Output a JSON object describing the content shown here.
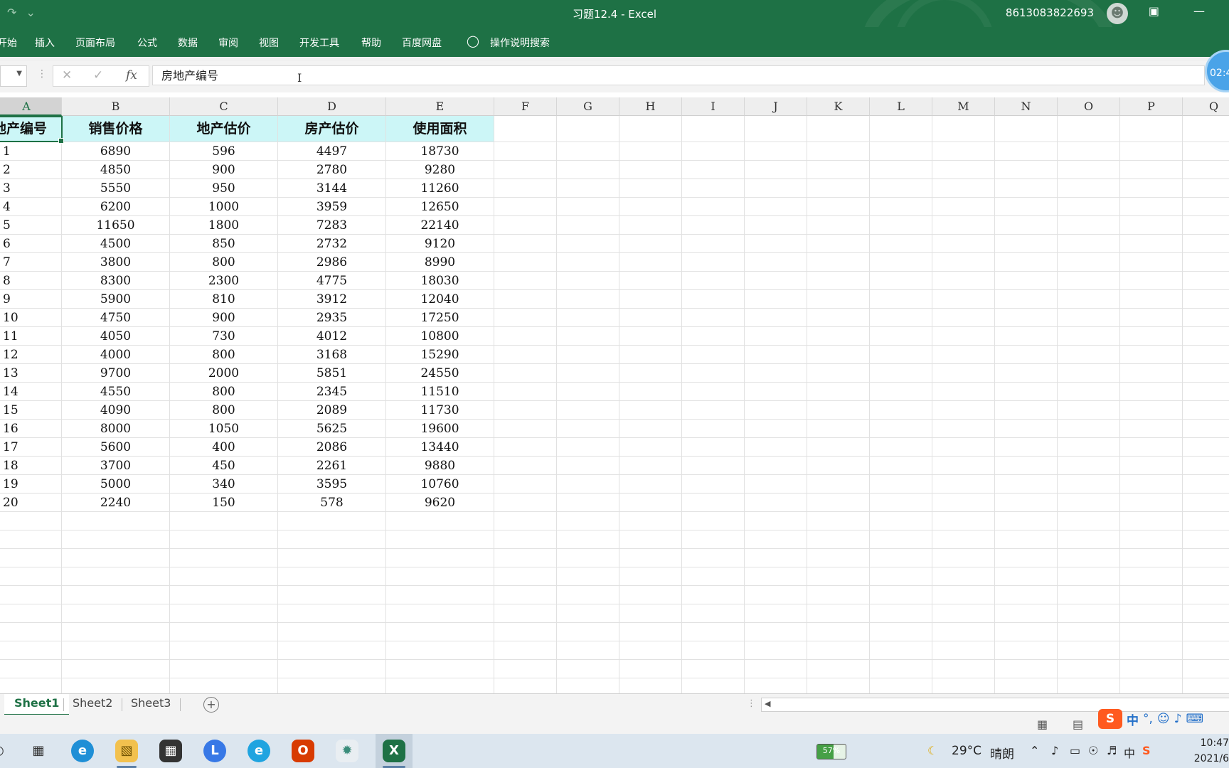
{
  "window": {
    "title": "习题12.4  -  Excel",
    "account": "8613083822693",
    "qat_redo": "↷",
    "qat_menu": "⌄"
  },
  "ribbon": {
    "tabs": [
      "开始",
      "插入",
      "页面布局",
      "公式",
      "数据",
      "审阅",
      "视图",
      "开发工具",
      "帮助",
      "百度网盘"
    ],
    "search": "操作说明搜索"
  },
  "formula_bar": {
    "cancel": "✕",
    "enter": "✓",
    "fx": "fx",
    "content": "房地产编号"
  },
  "timer": "02:4",
  "columns": [
    "A",
    "B",
    "C",
    "D",
    "E",
    "F",
    "G",
    "H",
    "I",
    "J",
    "K",
    "L",
    "M",
    "N",
    "O",
    "P",
    "Q"
  ],
  "table": {
    "headers": [
      "地产编号",
      "销售价格",
      "地产估价",
      "房产估价",
      "使用面积"
    ],
    "rows": [
      [
        "1",
        "6890",
        "596",
        "4497",
        "18730"
      ],
      [
        "2",
        "4850",
        "900",
        "2780",
        "9280"
      ],
      [
        "3",
        "5550",
        "950",
        "3144",
        "11260"
      ],
      [
        "4",
        "6200",
        "1000",
        "3959",
        "12650"
      ],
      [
        "5",
        "11650",
        "1800",
        "7283",
        "22140"
      ],
      [
        "6",
        "4500",
        "850",
        "2732",
        "9120"
      ],
      [
        "7",
        "3800",
        "800",
        "2986",
        "8990"
      ],
      [
        "8",
        "8300",
        "2300",
        "4775",
        "18030"
      ],
      [
        "9",
        "5900",
        "810",
        "3912",
        "12040"
      ],
      [
        "10",
        "4750",
        "900",
        "2935",
        "17250"
      ],
      [
        "11",
        "4050",
        "730",
        "4012",
        "10800"
      ],
      [
        "12",
        "4000",
        "800",
        "3168",
        "15290"
      ],
      [
        "13",
        "9700",
        "2000",
        "5851",
        "24550"
      ],
      [
        "14",
        "4550",
        "800",
        "2345",
        "11510"
      ],
      [
        "15",
        "4090",
        "800",
        "2089",
        "11730"
      ],
      [
        "16",
        "8000",
        "1050",
        "5625",
        "19600"
      ],
      [
        "17",
        "5600",
        "400",
        "2086",
        "13440"
      ],
      [
        "18",
        "3700",
        "450",
        "2261",
        "9880"
      ],
      [
        "19",
        "5000",
        "340",
        "3595",
        "10760"
      ],
      [
        "20",
        "2240",
        "150",
        "578",
        "9620"
      ]
    ]
  },
  "sheets": [
    "Sheet1",
    "Sheet2",
    "Sheet3"
  ],
  "active_sheet": "Sheet1",
  "ime": {
    "logo": "S",
    "lang": "中"
  },
  "taskbar": {
    "battery": "57%",
    "battery_level": 0.57,
    "weather_temp": "29°C",
    "weather_desc": "晴朗",
    "ime_lang": "中",
    "time": "10:47",
    "date": "2021/6"
  },
  "colors": {
    "excel_green": "#1e7145",
    "header_highlight": "#ccf6f7"
  }
}
